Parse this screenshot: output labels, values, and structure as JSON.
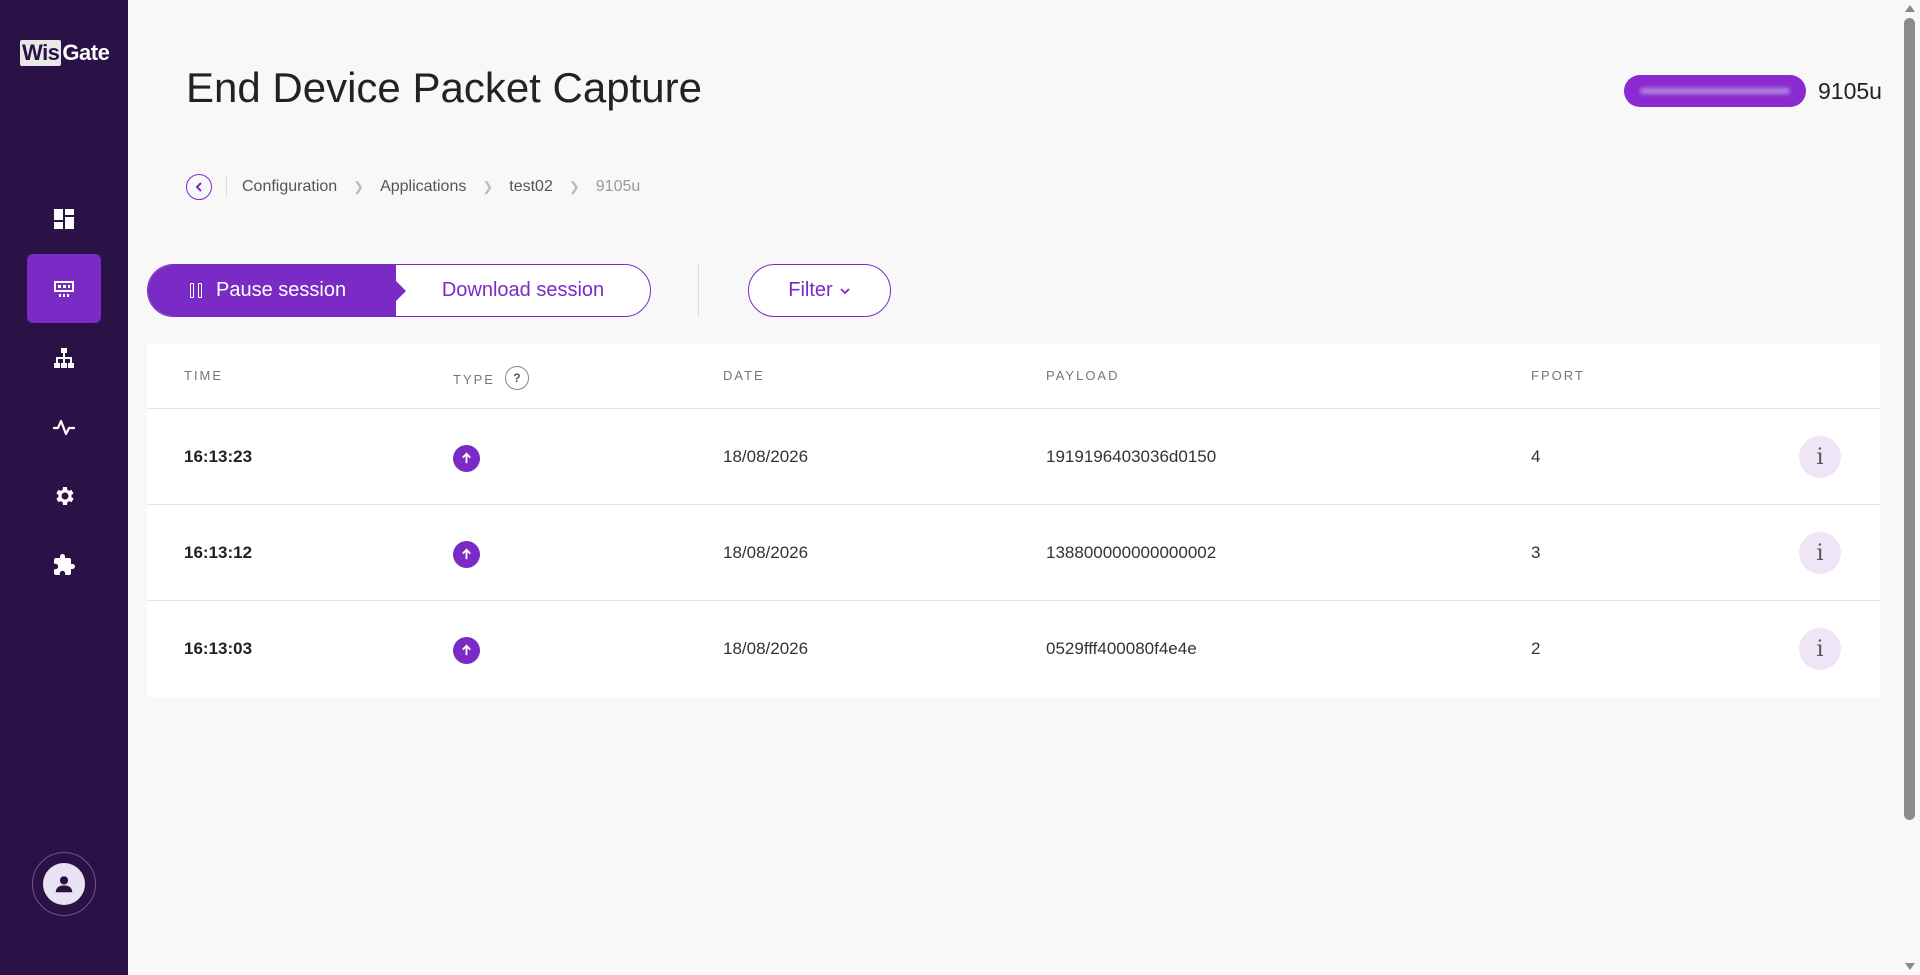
{
  "logo": {
    "part1": "Wis",
    "part2": "Gate"
  },
  "sidebar": {
    "items": [
      {
        "name": "dashboard",
        "icon": "dashboard-icon"
      },
      {
        "name": "packet-capture",
        "icon": "packet-icon",
        "active": true
      },
      {
        "name": "network",
        "icon": "network-tree-icon"
      },
      {
        "name": "activity",
        "icon": "activity-icon"
      },
      {
        "name": "settings",
        "icon": "gear-icon"
      },
      {
        "name": "extensions",
        "icon": "puzzle-icon"
      }
    ],
    "avatar_icon": "user-icon"
  },
  "header": {
    "title": "End Device Packet Capture",
    "device_name": "9105u"
  },
  "breadcrumb": {
    "items": [
      "Configuration",
      "Applications",
      "test02"
    ],
    "current": "9105u"
  },
  "toolbar": {
    "pause_label": "Pause session",
    "download_label": "Download session",
    "filter_label": "Filter"
  },
  "table": {
    "columns": [
      "TIME",
      "TYPE",
      "DATE",
      "PAYLOAD",
      "FPORT"
    ],
    "help_symbol": "?",
    "info_symbol": "i",
    "rows": [
      {
        "time": "16:13:23",
        "type": "uplink",
        "date": "18/08/2026",
        "payload": "1919196403036d0150",
        "fport": "4"
      },
      {
        "time": "16:13:12",
        "type": "uplink",
        "date": "18/08/2026",
        "payload": "138800000000000002",
        "fport": "3"
      },
      {
        "time": "16:13:03",
        "type": "uplink",
        "date": "18/08/2026",
        "payload": "0529fff400080f4e4e",
        "fport": "2"
      }
    ]
  },
  "colors": {
    "sidebar_bg": "#2a1247",
    "accent": "#7a2bc6",
    "page_bg": "#f8f8f8"
  }
}
